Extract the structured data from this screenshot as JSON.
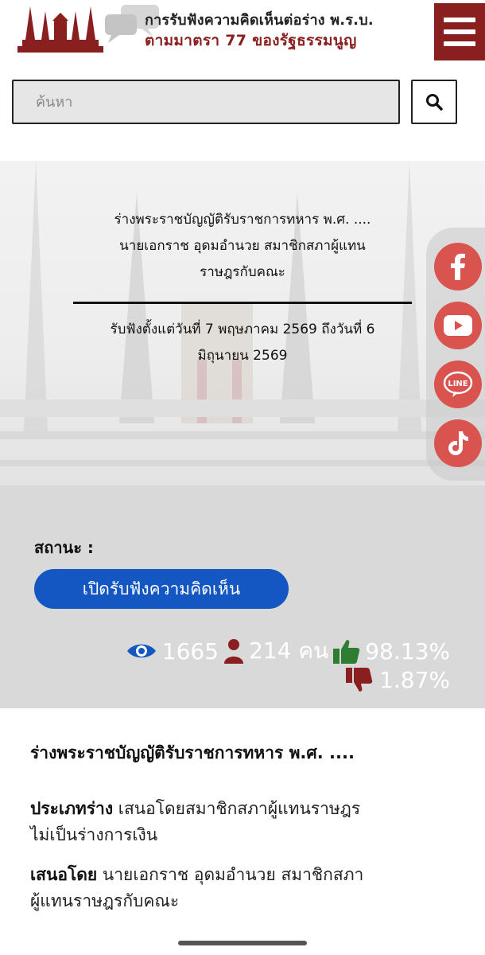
{
  "header": {
    "title_line1": "การรับฟังความคิดเห็นต่อร่าง พ.ร.บ.",
    "title_line2": "ตามมาตรา 77 ของรัฐธรรมนูญ",
    "brand_color": "#8a1f1f"
  },
  "search": {
    "placeholder": "ค้นหา",
    "value": ""
  },
  "hero": {
    "title_lines": [
      "ร่างพระราชบัญญัติรับราชการทหาร พ.ศ. ....",
      "นายเอกราช อุดมอำนวย สมาชิกสภาผู้แทน",
      "ราษฎรกับคณะ"
    ],
    "period_lines": [
      "รับฟังตั้งแต่วันที่ 7 พฤษภาคม 2569 ถึงวันที่ 6",
      "มิถุนายน 2569"
    ]
  },
  "social": [
    {
      "name": "facebook-icon"
    },
    {
      "name": "youtube-icon"
    },
    {
      "name": "line-icon",
      "label": "LINE"
    },
    {
      "name": "tiktok-icon"
    }
  ],
  "status": {
    "label": "สถานะ :",
    "badge": "เปิดรับฟังความคิดเห็น",
    "badge_color": "#1457c2",
    "views": "1665",
    "participants": "214 คน",
    "agree": "98.13%",
    "disagree": "1.87%"
  },
  "details": {
    "title": "ร่างพระราชบัญญัติรับราชการทหาร พ.ศ. ....",
    "type_label": "ประเภทร่าง",
    "type_value_line1": "เสนอโดยสมาชิกสภาผู้แทนราษฎร",
    "type_value_line2": "ไม่เป็นร่างการเงิน",
    "proposer_label": "เสนอโดย",
    "proposer_value_line1": "นายเอกราช อุดมอำนวย สมาชิกสภา",
    "proposer_value_line2": "ผู้แทนราษฎรกับคณะ"
  }
}
